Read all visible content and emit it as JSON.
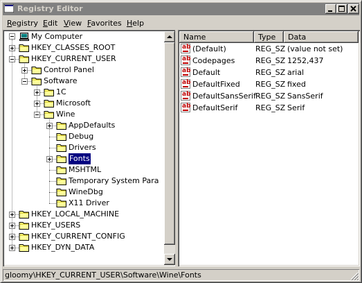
{
  "window": {
    "title": "Registry Editor"
  },
  "menu": [
    {
      "label": "Registry",
      "accel": "R",
      "rest": "egistry"
    },
    {
      "label": "Edit",
      "accel": "E",
      "rest": "dit"
    },
    {
      "label": "View",
      "accel": "V",
      "rest": "iew"
    },
    {
      "label": "Favorites",
      "accel": "F",
      "rest": "avorites"
    },
    {
      "label": "Help",
      "accel": "H",
      "rest": "elp"
    }
  ],
  "tree": {
    "root": "My Computer",
    "nodes": [
      {
        "label": "HKEY_CLASSES_ROOT",
        "level": 1,
        "expander": "plus"
      },
      {
        "label": "HKEY_CURRENT_USER",
        "level": 1,
        "expander": "minus"
      },
      {
        "label": "Control Panel",
        "level": 2,
        "expander": "plus"
      },
      {
        "label": "Software",
        "level": 2,
        "expander": "minus"
      },
      {
        "label": "1C",
        "level": 3,
        "expander": "plus"
      },
      {
        "label": "Microsoft",
        "level": 3,
        "expander": "plus"
      },
      {
        "label": "Wine",
        "level": 3,
        "expander": "minus"
      },
      {
        "label": "AppDefaults",
        "level": 4,
        "expander": "plus"
      },
      {
        "label": "Debug",
        "level": 4,
        "expander": "none"
      },
      {
        "label": "Drivers",
        "level": 4,
        "expander": "none"
      },
      {
        "label": "Fonts",
        "level": 4,
        "expander": "plus",
        "selected": true
      },
      {
        "label": "MSHTML",
        "level": 4,
        "expander": "none"
      },
      {
        "label": "Temporary System Para",
        "level": 4,
        "expander": "none"
      },
      {
        "label": "WineDbg",
        "level": 4,
        "expander": "none"
      },
      {
        "label": "X11 Driver",
        "level": 4,
        "expander": "none"
      },
      {
        "label": "HKEY_LOCAL_MACHINE",
        "level": 1,
        "expander": "plus"
      },
      {
        "label": "HKEY_USERS",
        "level": 1,
        "expander": "plus"
      },
      {
        "label": "HKEY_CURRENT_CONFIG",
        "level": 1,
        "expander": "plus"
      },
      {
        "label": "HKEY_DYN_DATA",
        "level": 1,
        "expander": "plus"
      }
    ]
  },
  "list": {
    "columns": [
      "Name",
      "Type",
      "Data"
    ],
    "rows": [
      {
        "name": "(Default)",
        "type": "REG_SZ",
        "data": "(value not set)"
      },
      {
        "name": "Codepages",
        "type": "REG_SZ",
        "data": "1252,437"
      },
      {
        "name": "Default",
        "type": "REG_SZ",
        "data": "arial"
      },
      {
        "name": "DefaultFixed",
        "type": "REG_SZ",
        "data": "fixed"
      },
      {
        "name": "DefaultSansSerif",
        "type": "REG_SZ",
        "data": "SansSerif"
      },
      {
        "name": "DefaultSerif",
        "type": "REG_SZ",
        "data": "Serif"
      }
    ]
  },
  "status": {
    "path": "gloomy\\HKEY_CURRENT_USER\\Software\\Wine\\Fonts"
  },
  "colors": {
    "selection": "#000080",
    "titlebar_inactive": "#808080",
    "face": "#d4d0c8"
  },
  "icons": {
    "title": "registry-icon",
    "value": "string-value-icon",
    "folder": "folder-icon",
    "computer": "computer-icon"
  }
}
